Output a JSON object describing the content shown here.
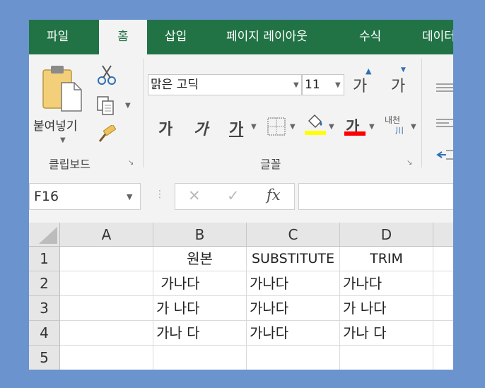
{
  "tabs": [
    {
      "label": "파일",
      "active": false
    },
    {
      "label": "홈",
      "active": true
    },
    {
      "label": "삽입",
      "active": false
    },
    {
      "label": "페이지 레이아웃",
      "active": false
    },
    {
      "label": "수식",
      "active": false
    },
    {
      "label": "데이터",
      "active": false
    }
  ],
  "clipboard": {
    "paste_label": "붙여넣기",
    "group_label": "클립보드"
  },
  "font": {
    "name": "맑은 고딕",
    "size": "11",
    "grow_label": "가",
    "shrink_label": "가",
    "bold_label": "가",
    "italic_label": "가",
    "underline_label": "가",
    "color_label": "가",
    "phonetic_label": "내천",
    "group_label": "글꼴",
    "fill_color": "#ffff00",
    "font_color": "#ff0000"
  },
  "formula_bar": {
    "name_box": "F16",
    "fx_label": "fx",
    "cancel_glyph": "✕",
    "enter_glyph": "✓"
  },
  "sheet": {
    "columns": [
      "A",
      "B",
      "C",
      "D"
    ],
    "rows": [
      {
        "num": "1",
        "cells": [
          "",
          "원본",
          "SUBSTITUTE",
          "TRIM"
        ]
      },
      {
        "num": "2",
        "cells": [
          "",
          " 가나다",
          "가나다",
          "가나다"
        ]
      },
      {
        "num": "3",
        "cells": [
          "",
          "가 나다",
          "가나다",
          "가 나다"
        ]
      },
      {
        "num": "4",
        "cells": [
          "",
          "가나 다",
          "가나다",
          "가나 다"
        ]
      },
      {
        "num": "5",
        "cells": [
          "",
          "",
          "",
          ""
        ]
      }
    ]
  }
}
